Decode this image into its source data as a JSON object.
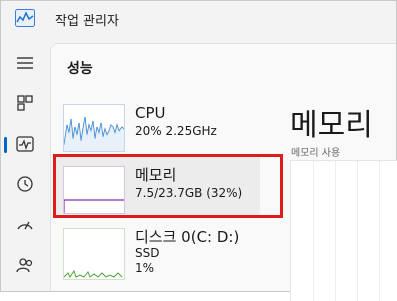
{
  "app": {
    "title": "작업 관리자",
    "icon": "task-manager-icon"
  },
  "nav": {
    "items": [
      {
        "id": "menu",
        "icon": "hamburger-icon"
      },
      {
        "id": "processes",
        "icon": "processes-icon"
      },
      {
        "id": "performance",
        "icon": "performance-icon",
        "active": true
      },
      {
        "id": "app-history",
        "icon": "history-icon"
      },
      {
        "id": "startup",
        "icon": "startup-icon"
      },
      {
        "id": "users",
        "icon": "users-icon"
      }
    ],
    "accent": "#0067c0"
  },
  "section": {
    "title": "성능"
  },
  "resources": [
    {
      "name": "CPU",
      "line1": "20%  2.25GHz",
      "graph_color": "#1c74c9"
    },
    {
      "name": "메모리",
      "line1": "7.5/23.7GB (32%)",
      "graph_color": "#8b2fb0",
      "selected": true
    },
    {
      "name": "디스크 0(C: D:)",
      "line1": "SSD",
      "line2": "1%",
      "graph_color": "#4aa53a"
    }
  ],
  "detail": {
    "title": "메모리",
    "subtitle": "메모리 사용"
  },
  "highlight_color": "#e01b1b"
}
